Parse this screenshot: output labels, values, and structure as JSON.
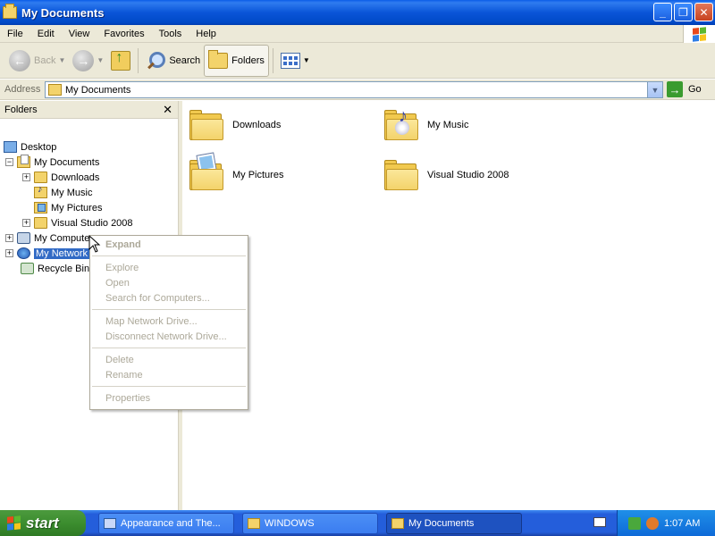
{
  "window": {
    "title": "My Documents",
    "minimize": "_",
    "restore": "❐",
    "close": "✕"
  },
  "menu": [
    "File",
    "Edit",
    "View",
    "Favorites",
    "Tools",
    "Help"
  ],
  "toolbar": {
    "back_label": "Back",
    "search_label": "Search",
    "folders_label": "Folders"
  },
  "address": {
    "label": "Address",
    "value": "My Documents",
    "go_label": "Go"
  },
  "folder_pane": {
    "title": "Folders",
    "close": "✕",
    "items": [
      {
        "label": "Desktop",
        "icon": "desktop-icon"
      },
      {
        "label": "My Documents",
        "icon": "my-documents-icon",
        "expander": "−"
      },
      {
        "label": "Downloads",
        "icon": "folder-icon",
        "expander": "+"
      },
      {
        "label": "My Music",
        "icon": "my-music-icon"
      },
      {
        "label": "My Pictures",
        "icon": "my-pictures-icon"
      },
      {
        "label": "Visual Studio 2008",
        "icon": "folder-icon",
        "expander": "+"
      },
      {
        "label": "My Computer",
        "icon": "my-computer-icon",
        "expander": "+"
      },
      {
        "label": "My Network Places",
        "icon": "network-places-icon",
        "expander": "+",
        "selected": true
      },
      {
        "label": "Recycle Bin",
        "icon": "recycle-bin-icon"
      }
    ]
  },
  "content_items": [
    {
      "label": "Downloads",
      "icon": "folder-icon"
    },
    {
      "label": "My Music",
      "icon": "my-music-folder-icon"
    },
    {
      "label": "My Pictures",
      "icon": "my-pictures-folder-icon"
    },
    {
      "label": "Visual Studio 2008",
      "icon": "folder-icon"
    }
  ],
  "context_menu": {
    "items": [
      {
        "label": "Expand",
        "default": true
      },
      {
        "label": "Explore"
      },
      {
        "label": "Open"
      },
      {
        "label": "Search for Computers..."
      },
      {
        "label": "Map Network Drive..."
      },
      {
        "label": "Disconnect Network Drive..."
      },
      {
        "label": "Delete"
      },
      {
        "label": "Rename"
      },
      {
        "label": "Properties"
      }
    ]
  },
  "taskbar": {
    "start_label": "start",
    "tasks": [
      {
        "label": "Appearance and The...",
        "icon": "appearance-icon"
      },
      {
        "label": "WINDOWS",
        "icon": "folder-icon"
      },
      {
        "label": "My Documents",
        "icon": "folder-icon",
        "active": true
      }
    ],
    "clock": "1:07 AM"
  },
  "colors": {
    "titlebar_blue": "#0a55d8",
    "selection": "#316ac5",
    "chrome": "#ece9d8",
    "start_green": "#3c8d2f",
    "disabled_text": "#aca899"
  }
}
